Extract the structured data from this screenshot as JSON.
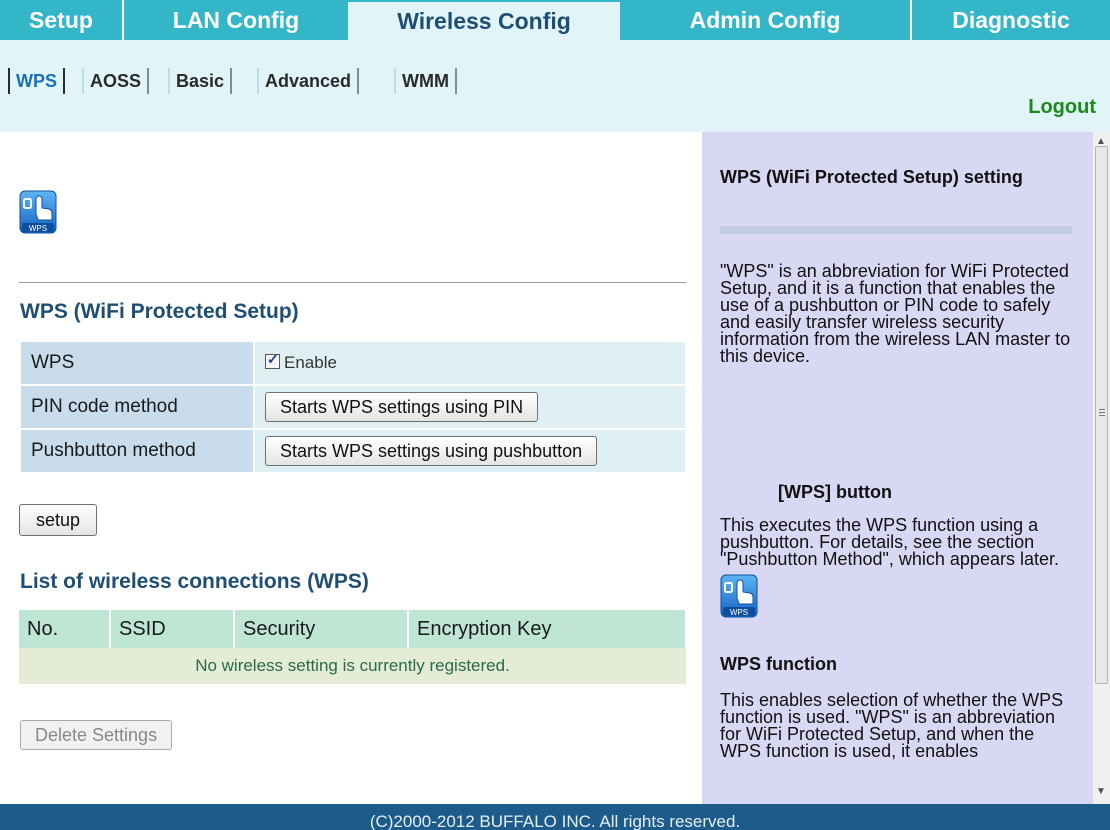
{
  "nav": {
    "tabs": [
      {
        "label": "Setup",
        "active": false
      },
      {
        "label": "LAN Config",
        "active": false
      },
      {
        "label": "Wireless Config",
        "active": true
      },
      {
        "label": "Admin Config",
        "active": false
      },
      {
        "label": "Diagnostic",
        "active": false
      }
    ],
    "subtabs": [
      {
        "label": "WPS",
        "active": true
      },
      {
        "label": "AOSS",
        "active": false
      },
      {
        "label": "Basic",
        "active": false
      },
      {
        "label": "Advanced",
        "active": false
      },
      {
        "label": "WMM",
        "active": false
      }
    ],
    "logout": "Logout"
  },
  "main": {
    "wps_logo_text": "WPS",
    "section_title": "WPS (WiFi Protected Setup)",
    "rows": [
      {
        "label": "WPS",
        "checkbox_label": "Enable",
        "checked": true
      },
      {
        "label": "PIN code method",
        "button": "Starts WPS settings using PIN"
      },
      {
        "label": "Pushbutton method",
        "button": "Starts WPS settings using pushbutton"
      }
    ],
    "setup_button": "setup",
    "connections_title": "List of wireless connections (WPS)",
    "connections_columns": [
      "No.",
      "SSID",
      "Security",
      "Encryption Key"
    ],
    "connections_empty": "No wireless setting is currently registered.",
    "delete_button": "Delete Settings"
  },
  "help": {
    "title": "WPS (WiFi Protected Setup) setting",
    "intro": "\"WPS\" is an abbreviation for WiFi Protected Setup, and it is a function that enables the use of a pushbutton or PIN code to safely and easily transfer wireless security information from the wireless LAN master to this device.",
    "button_heading": "[WPS] button",
    "button_text": "This executes the WPS function using a pushbutton. For details, see the section \"Pushbutton Method\", which appears later.",
    "function_heading": "WPS function",
    "function_text": "This enables selection of whether the WPS function is used. \"WPS\" is an abbreviation for WiFi Protected Setup, and when the WPS function is used, it enables"
  },
  "footer": "(C)2000-2012 BUFFALO INC. All rights reserved.",
  "colors": {
    "nav_bg": "#32b6c8",
    "subnav_bg": "#e1f4f7",
    "title_blue": "#1f4e73",
    "help_bg": "#d8d8f4",
    "footer_bg": "#1d5b8b",
    "logout_green": "#1a8a1a"
  }
}
